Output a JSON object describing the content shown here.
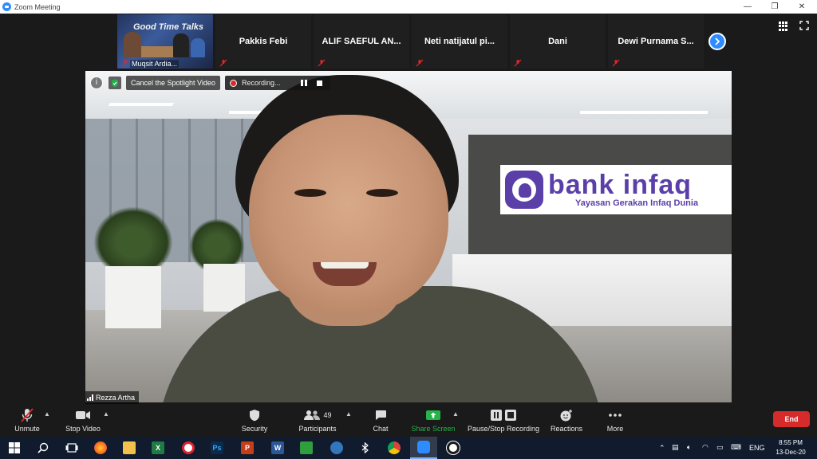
{
  "window": {
    "title": "Zoom Meeting",
    "minimize": "—",
    "restore": "❐",
    "close": "✕"
  },
  "thumbnails": [
    {
      "name": "Muqsit Ardia...",
      "poster_title": "Good Time Talks",
      "muted": true
    },
    {
      "name": "Pakkis Febi",
      "muted": true
    },
    {
      "name": "ALIF SAEFUL AN...",
      "muted": true
    },
    {
      "name": "Neti natijatul pi...",
      "muted": true
    },
    {
      "name": "Dani",
      "muted": true
    },
    {
      "name": "Dewi Purnama S...",
      "muted": true
    }
  ],
  "overlay": {
    "info": "i",
    "spotlight_label": "Cancel the Spotlight Video",
    "recording_label": "Recording...",
    "speaker_name": "Rezza Artha"
  },
  "background_logo": {
    "brand": "bank infaq",
    "tagline": "Yayasan Gerakan Infaq Dunia"
  },
  "toolbar": {
    "unmute": "Unmute",
    "stop_video": "Stop Video",
    "security": "Security",
    "participants": "Participants",
    "participant_count": "49",
    "chat": "Chat",
    "share_screen": "Share Screen",
    "pause_stop_recording": "Pause/Stop Recording",
    "reactions": "Reactions",
    "more": "More",
    "end": "End",
    "share_color": "#25b34a",
    "end_color": "#d52b2b"
  },
  "taskbar": {
    "language": "ENG",
    "time": "8:55 PM",
    "date": "13-Dec-20"
  }
}
